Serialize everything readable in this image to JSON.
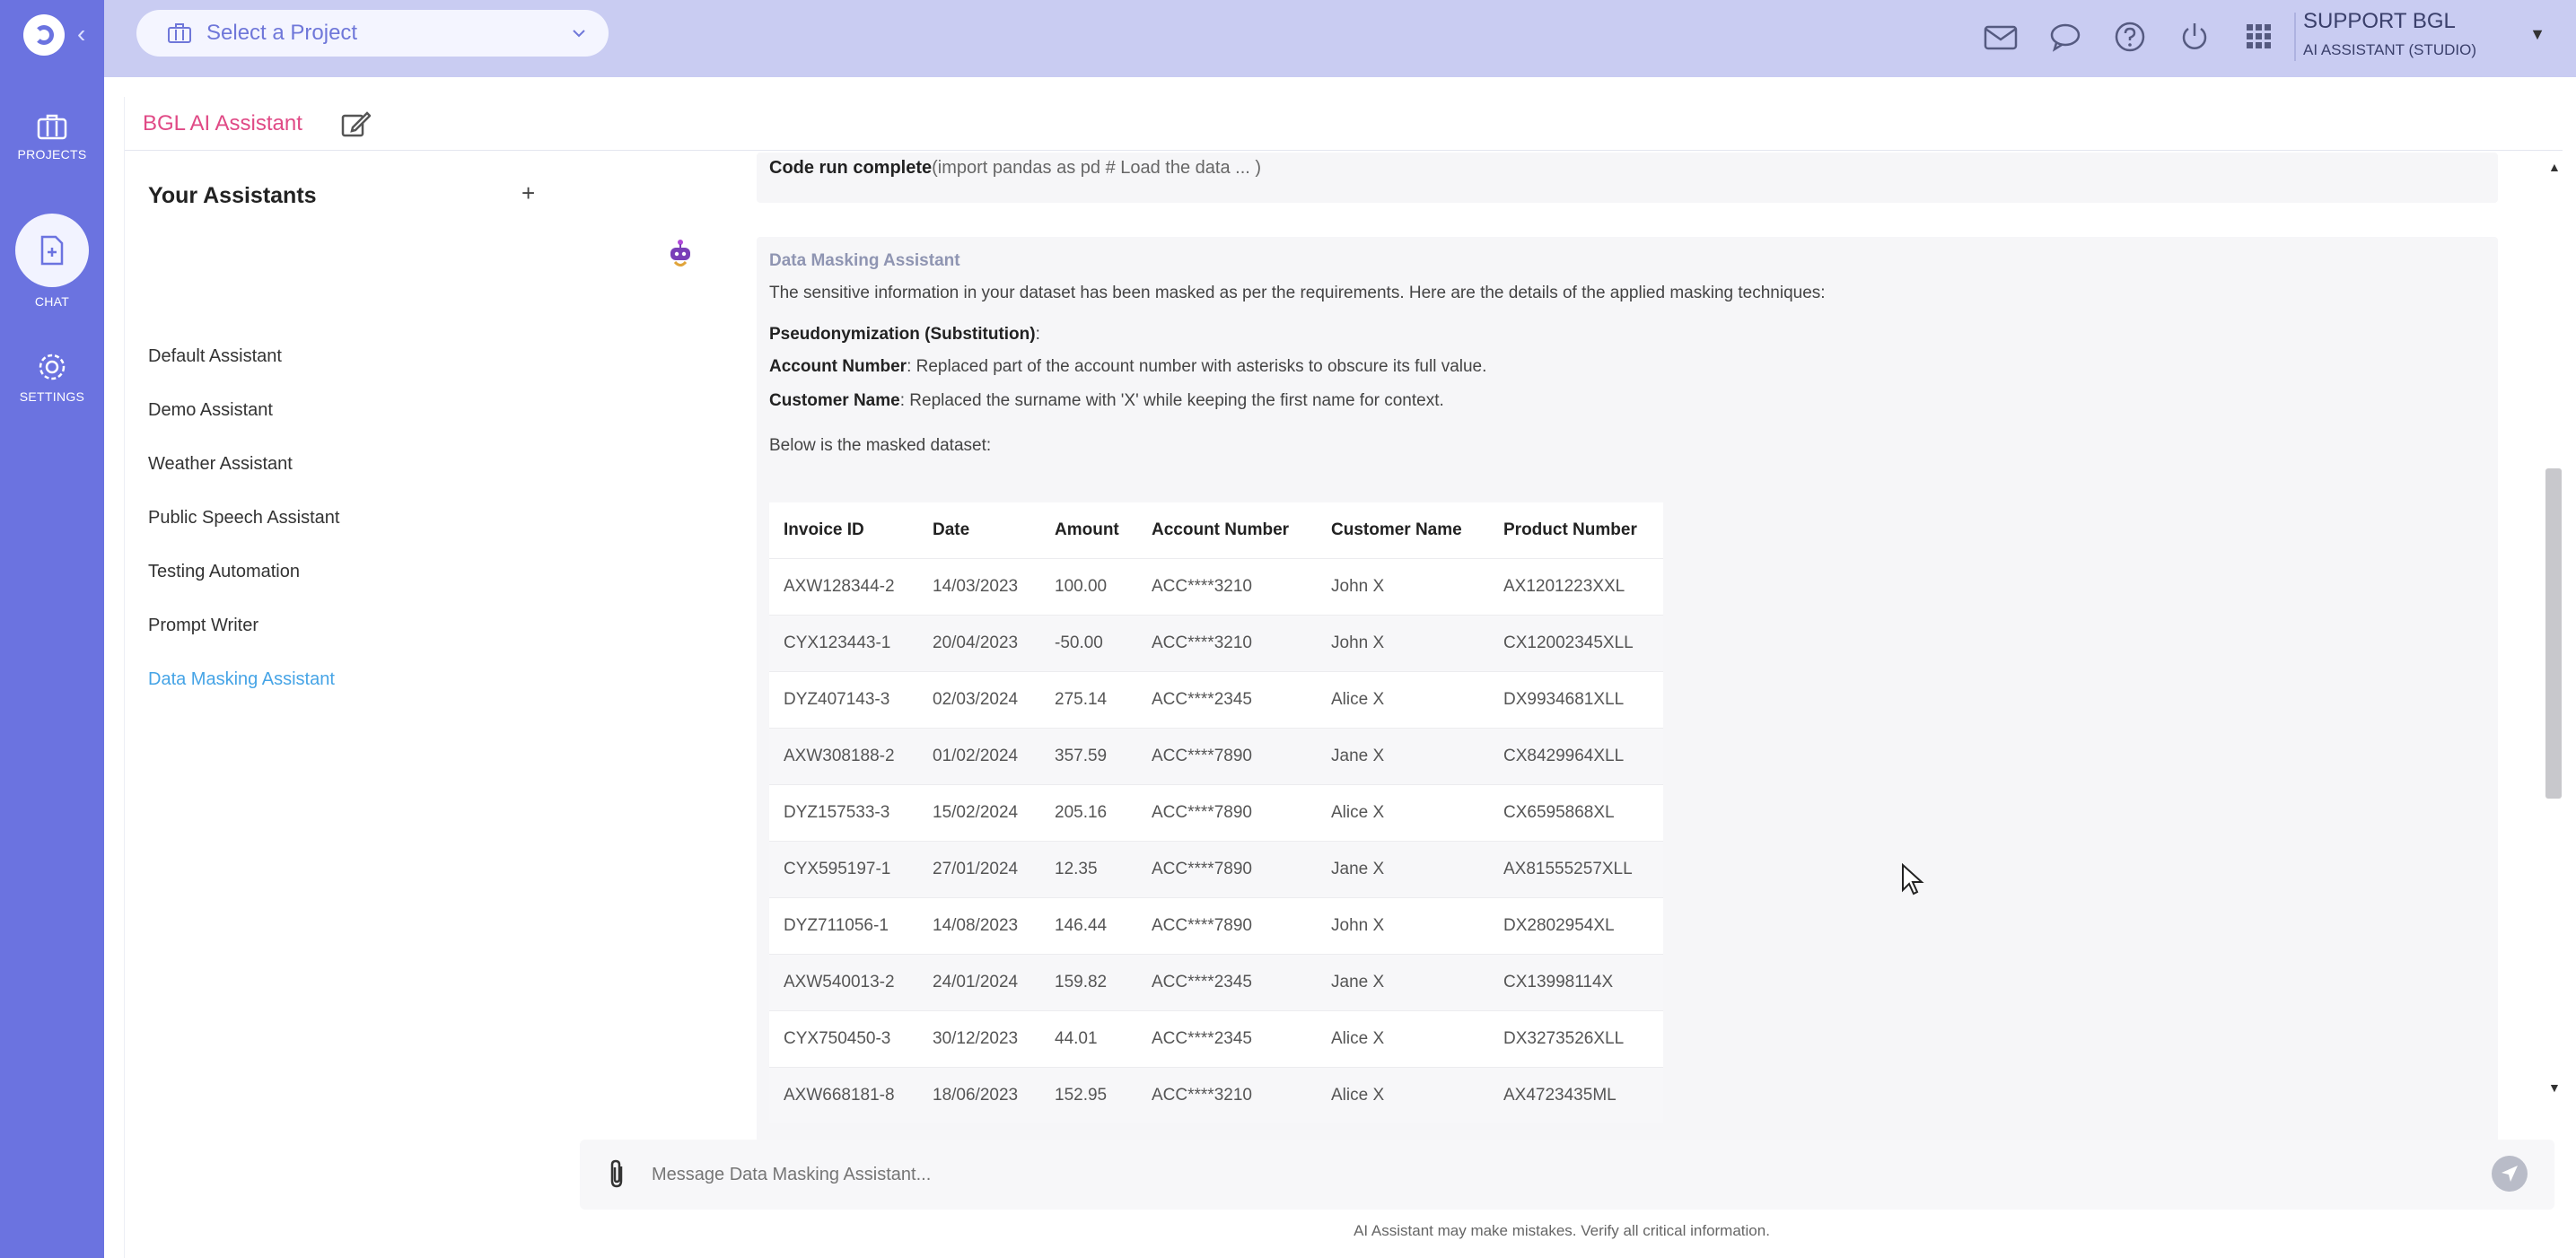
{
  "top": {
    "project_select_placeholder": "Select a Project",
    "user_name": "SUPPORT BGL",
    "user_role": "AI ASSISTANT (STUDIO)"
  },
  "rail": {
    "items": [
      {
        "label": "PROJECTS",
        "icon": "briefcase-icon"
      },
      {
        "label": "CHAT",
        "icon": "chat-document-icon"
      },
      {
        "label": "SETTINGS",
        "icon": "gear-icon"
      }
    ]
  },
  "panel": {
    "title": "BGL AI Assistant"
  },
  "assistants": {
    "heading": "Your Assistants",
    "add": "+",
    "items": [
      "Default Assistant",
      "Demo Assistant",
      "Weather Assistant",
      "Public Speech Assistant",
      "Testing Automation",
      "Prompt Writer",
      "Data Masking Assistant"
    ]
  },
  "chat": {
    "code_run_label": "Code run complete",
    "code_run_detail": "(import pandas as pd # Load the data ... )",
    "sender": "Data Masking Assistant",
    "intro": "The sensitive information in your dataset has been masked as per the requirements. Here are the details of the applied masking techniques:",
    "technique_heading": "Pseudonymization (Substitution)",
    "technique_heading_suffix": ":",
    "account_label": "Account Number",
    "account_text": ": Replaced part of the account number with asterisks to obscure its full value.",
    "customer_label": "Customer Name",
    "customer_text": ": Replaced the surname with 'X' while keeping the first name for context.",
    "below": "Below is the masked dataset:",
    "table": {
      "headers": [
        "Invoice ID",
        "Date",
        "Amount",
        "Account Number",
        "Customer Name",
        "Product Number"
      ],
      "rows": [
        [
          "AXW128344-2",
          "14/03/2023",
          "100.00",
          "ACC****3210",
          "John X",
          "AX1201223XXL"
        ],
        [
          "CYX123443-1",
          "20/04/2023",
          "-50.00",
          "ACC****3210",
          "John X",
          "CX12002345XLL"
        ],
        [
          "DYZ407143-3",
          "02/03/2024",
          "275.14",
          "ACC****2345",
          "Alice X",
          "DX9934681XLL"
        ],
        [
          "AXW308188-2",
          "01/02/2024",
          "357.59",
          "ACC****7890",
          "Jane X",
          "CX8429964XLL"
        ],
        [
          "DYZ157533-3",
          "15/02/2024",
          "205.16",
          "ACC****7890",
          "Alice X",
          "CX6595868XL"
        ],
        [
          "CYX595197-1",
          "27/01/2024",
          "12.35",
          "ACC****7890",
          "Jane X",
          "AX81555257XLL"
        ],
        [
          "DYZ711056-1",
          "14/08/2023",
          "146.44",
          "ACC****7890",
          "John X",
          "DX2802954XL"
        ],
        [
          "AXW540013-2",
          "24/01/2024",
          "159.82",
          "ACC****2345",
          "Jane X",
          "CX13998114X"
        ],
        [
          "CYX750450-3",
          "30/12/2023",
          "44.01",
          "ACC****2345",
          "Alice X",
          "DX3273526XLL"
        ],
        [
          "AXW668181-8",
          "18/06/2023",
          "152.95",
          "ACC****3210",
          "Alice X",
          "AX4723435ML"
        ]
      ]
    }
  },
  "composer": {
    "placeholder": "Message Data Masking Assistant...",
    "disclaimer": "AI Assistant may make mistakes. Verify all critical information."
  },
  "colors": {
    "rail": "#6b73e0",
    "topbar": "#c9ccf2",
    "title_accent": "#e04a86",
    "active_item": "#46a4e6"
  }
}
